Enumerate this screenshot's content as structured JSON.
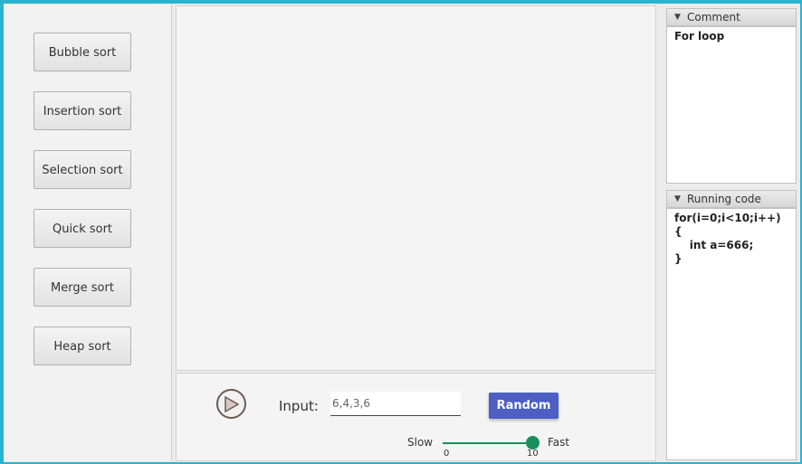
{
  "sidebar": {
    "buttons": [
      {
        "label": "Bubble sort"
      },
      {
        "label": "Insertion sort"
      },
      {
        "label": "Selection sort"
      },
      {
        "label": "Quick sort"
      },
      {
        "label": "Merge sort"
      },
      {
        "label": "Heap sort"
      }
    ]
  },
  "controls": {
    "play_icon": "play-icon",
    "input_label": "Input:",
    "input_value": "6,4,3,6",
    "random_label": "Random",
    "speed": {
      "slow_label": "Slow",
      "fast_label": "Fast",
      "min": "0",
      "max": "10",
      "value": 10
    }
  },
  "comment_panel": {
    "title": "Comment",
    "text": "For loop"
  },
  "code_panel": {
    "title": "Running code",
    "lines": [
      "for(i=0;i<10;i++)",
      "{",
      "    int a=666;",
      "}"
    ]
  },
  "colors": {
    "background": "#2ab4cf",
    "random_button": "#4d5fc3",
    "slider": "#179159"
  }
}
